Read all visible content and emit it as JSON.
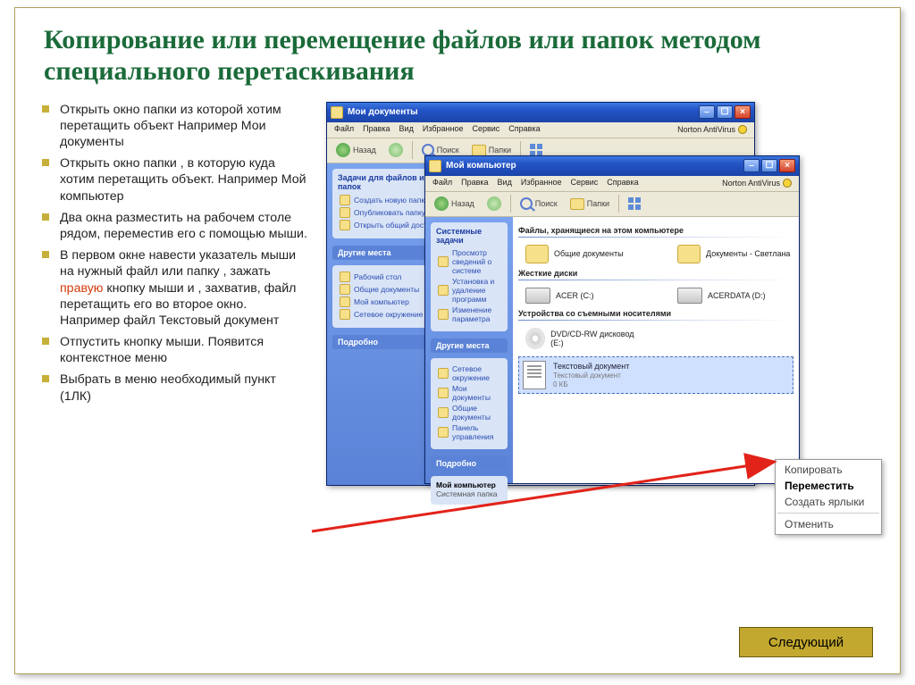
{
  "title": "Копирование или  перемещение файлов или папок методом специального перетаскивания",
  "bullets": [
    {
      "pre": "Открыть окно папки из которой хотим перетащить объект Например Мои документы",
      "hl": "",
      "post": ""
    },
    {
      "pre": "Открыть окно папки , в которую куда хотим перетащить объект. Например Мой компьютер",
      "hl": "",
      "post": ""
    },
    {
      "pre": "Два окна разместить на рабочем столе рядом, переместив его с помощью мыши.",
      "hl": "",
      "post": ""
    },
    {
      "pre": "В первом окне навести указатель мыши на нужный файл или папку , зажать ",
      "hl": "правую",
      "post": " кнопку мыши и , захватив, файл перетащить его во второе окно. Например файл Текстовый документ"
    },
    {
      "pre": "Отпустить кнопку мыши. Появится контекстное меню",
      "hl": "",
      "post": ""
    },
    {
      "pre": "Выбрать в меню необходимый пункт (1ЛК)",
      "hl": "",
      "post": ""
    }
  ],
  "win_docs": {
    "title": "Мои документы",
    "menu": [
      "Файл",
      "Правка",
      "Вид",
      "Избранное",
      "Сервис",
      "Справка"
    ],
    "av": "Norton AntiVirus",
    "toolbar": {
      "back": "Назад",
      "search": "Поиск",
      "folders": "Папки"
    },
    "side": {
      "tasks_hd": "Задачи для файлов и папок",
      "tasks": [
        "Создать новую папку",
        "Опубликовать папку",
        "Открыть общий доступ"
      ],
      "places_hd": "Другие места",
      "places": [
        "Рабочий стол",
        "Общие документы",
        "Мой компьютер",
        "Сетевое окружение"
      ],
      "details_hd": "Подробно"
    }
  },
  "win_comp": {
    "title": "Мой компьютер",
    "menu": [
      "Файл",
      "Правка",
      "Вид",
      "Избранное",
      "Сервис",
      "Справка"
    ],
    "av": "Norton AntiVirus",
    "toolbar": {
      "back": "Назад",
      "search": "Поиск",
      "folders": "Папки"
    },
    "side": {
      "tasks_hd": "Системные задачи",
      "tasks": [
        "Просмотр сведений о системе",
        "Установка и удаление программ",
        "Изменение параметра"
      ],
      "places_hd": "Другие места",
      "places": [
        "Сетевое окружение",
        "Мои документы",
        "Общие документы",
        "Панель управления"
      ],
      "details_hd": "Подробно",
      "details": [
        "Мой компьютер",
        "Системная папка"
      ]
    },
    "main": {
      "stored": "Файлы, хранящиеся на этом компьютере",
      "folders": [
        {
          "label": "Общие документы"
        },
        {
          "label": "Документы - Светлана"
        }
      ],
      "drives_hd": "Жесткие диски",
      "drives": [
        {
          "label": "ACER (C:)"
        },
        {
          "label": "ACERDATA (D:)"
        }
      ],
      "removable_hd": "Устройства со съемными носителями",
      "removable": [
        {
          "label": "DVD/CD-RW дисковод (E:)"
        }
      ],
      "sel": {
        "name": "Текстовый документ",
        "type": "Текстовый документ",
        "size": "0 КБ"
      }
    }
  },
  "context_menu": {
    "copy": "Копировать",
    "move": "Переместить",
    "shortcut": "Создать ярлыки",
    "cancel": "Отменить"
  },
  "next_label": "Следующий"
}
